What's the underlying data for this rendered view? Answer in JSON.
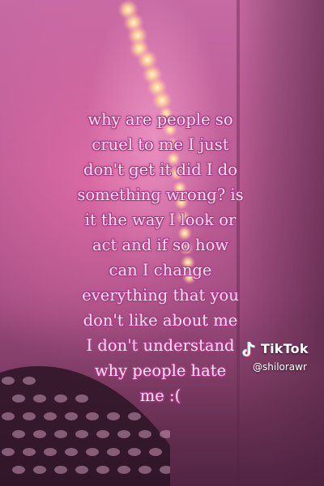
{
  "caption": {
    "lines": [
      "why are people so",
      "cruel to me I just",
      "don't get it did I do",
      "something wrong? is",
      "it the way I look or",
      "act and if so how",
      "can I change",
      "everything that you",
      "don't like about me",
      "I don't understand",
      "why people hate",
      "me :("
    ]
  },
  "watermark": {
    "brand": "TikTok",
    "handle": "@shilorawr",
    "logo_icon": "tiktok-note-icon"
  },
  "colors": {
    "caption_text": "#fbe4f1",
    "caption_outline": "#a33279",
    "background_pink": "#c76aa3",
    "lights": "#ffd98a"
  }
}
